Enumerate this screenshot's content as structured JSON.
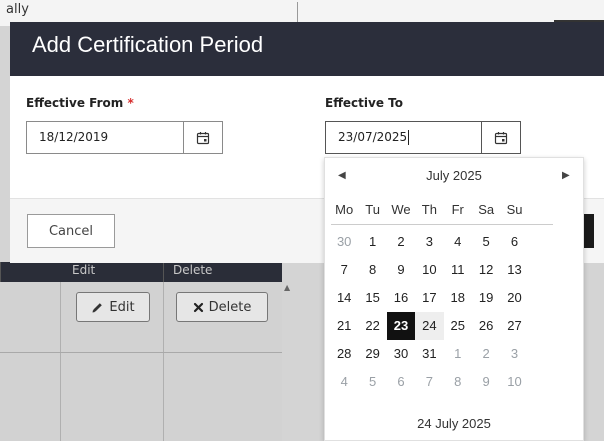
{
  "background": {
    "top_fragment": "ally",
    "grid_headers": [
      "Edit",
      "Delete"
    ],
    "edit_button_label": "Edit",
    "delete_button_label": "Delete"
  },
  "modal": {
    "title": "Add Certification Period",
    "from_label": "Effective From",
    "from_required_marker": "*",
    "from_value": "18/12/2019",
    "to_label": "Effective To",
    "to_value": "23/07/2025",
    "cancel_label": "Cancel"
  },
  "datepicker": {
    "month_label": "July 2025",
    "weekdays": [
      "Mo",
      "Tu",
      "We",
      "Th",
      "Fr",
      "Sa",
      "Su"
    ],
    "weeks": [
      [
        {
          "d": "30",
          "m": true
        },
        {
          "d": "1"
        },
        {
          "d": "2"
        },
        {
          "d": "3"
        },
        {
          "d": "4"
        },
        {
          "d": "5"
        },
        {
          "d": "6"
        }
      ],
      [
        {
          "d": "7"
        },
        {
          "d": "8"
        },
        {
          "d": "9"
        },
        {
          "d": "10"
        },
        {
          "d": "11"
        },
        {
          "d": "12"
        },
        {
          "d": "13"
        }
      ],
      [
        {
          "d": "14"
        },
        {
          "d": "15"
        },
        {
          "d": "16"
        },
        {
          "d": "17"
        },
        {
          "d": "18"
        },
        {
          "d": "19"
        },
        {
          "d": "20"
        }
      ],
      [
        {
          "d": "21"
        },
        {
          "d": "22"
        },
        {
          "d": "23",
          "s": true
        },
        {
          "d": "24",
          "t": true
        },
        {
          "d": "25"
        },
        {
          "d": "26"
        },
        {
          "d": "27"
        }
      ],
      [
        {
          "d": "28"
        },
        {
          "d": "29"
        },
        {
          "d": "30"
        },
        {
          "d": "31"
        },
        {
          "d": "1",
          "m": true
        },
        {
          "d": "2",
          "m": true
        },
        {
          "d": "3",
          "m": true
        }
      ],
      [
        {
          "d": "4",
          "m": true
        },
        {
          "d": "5",
          "m": true
        },
        {
          "d": "6",
          "m": true
        },
        {
          "d": "7",
          "m": true
        },
        {
          "d": "8",
          "m": true
        },
        {
          "d": "9",
          "m": true
        },
        {
          "d": "10",
          "m": true
        }
      ]
    ],
    "today_label": "24 July 2025"
  },
  "colors": {
    "header_bg": "#2b2e3b",
    "selected_day": "#111111",
    "required": "#d62d2d"
  },
  "icons": {
    "calendar": "calendar-icon",
    "prev": "triangle-left-icon",
    "next": "triangle-right-icon",
    "edit": "pencil-icon",
    "delete": "x-icon"
  }
}
